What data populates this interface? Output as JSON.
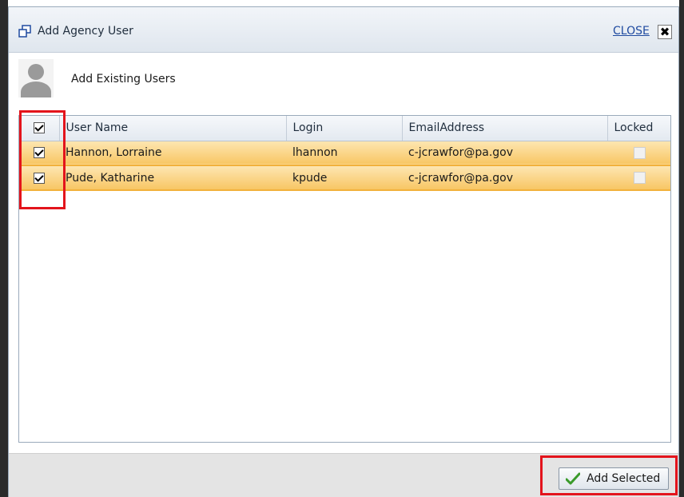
{
  "dialog": {
    "title": "Add Agency User",
    "close_label": "CLOSE",
    "close_glyph": "✖",
    "section_title": "Add Existing Users"
  },
  "grid": {
    "columns": [
      "User Name",
      "Login",
      "EmailAddress",
      "Locked"
    ],
    "header_checked": true,
    "rows": [
      {
        "checked": true,
        "user_name": "Hannon, Lorraine",
        "login": "lhannon",
        "email": "c-jcrawfor@pa.gov",
        "locked": false
      },
      {
        "checked": true,
        "user_name": "Pude, Katharine",
        "login": "kpude",
        "email": "c-jcrawfor@pa.gov",
        "locked": false
      }
    ]
  },
  "footer": {
    "add_selected_label": "Add Selected"
  },
  "colors": {
    "highlight_border": "#e3141c",
    "row_selected": "#f8c664",
    "titlebar": "#dfe6ee",
    "link": "#1f4aa0"
  },
  "icons": {
    "window": "window-restore-icon",
    "avatar": "user-silhouette-icon",
    "close": "close-x-icon",
    "add": "green-check-icon"
  }
}
